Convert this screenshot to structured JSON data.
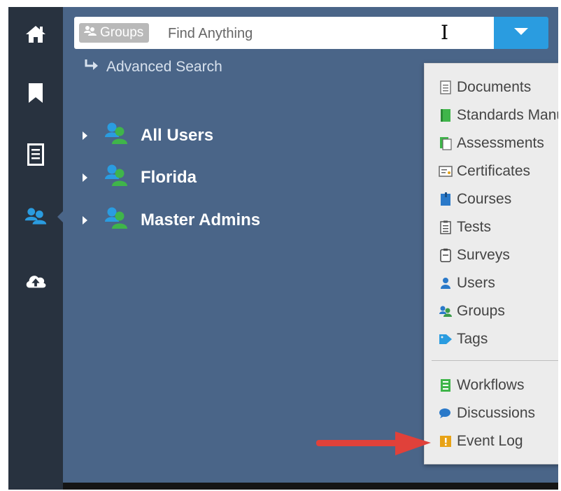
{
  "search": {
    "scope_label": "Groups",
    "placeholder": "Find Anything"
  },
  "advanced_search_label": "Advanced Search",
  "sidebar": {
    "items": [
      {
        "name": "home-icon"
      },
      {
        "name": "bookmark-icon"
      },
      {
        "name": "document-list-icon"
      },
      {
        "name": "users-icon"
      },
      {
        "name": "cloud-upload-icon"
      }
    ]
  },
  "groups_tree": [
    {
      "label": "All Users"
    },
    {
      "label": "Florida"
    },
    {
      "label": "Master Admins"
    }
  ],
  "menu": {
    "items": [
      {
        "label": "Documents",
        "icon": "document-icon"
      },
      {
        "label": "Standards Manuals",
        "icon": "manual-icon"
      },
      {
        "label": "Assessments",
        "icon": "assessment-icon"
      },
      {
        "label": "Certificates",
        "icon": "certificate-icon"
      },
      {
        "label": "Courses",
        "icon": "course-icon"
      },
      {
        "label": "Tests",
        "icon": "test-icon"
      },
      {
        "label": "Surveys",
        "icon": "survey-icon"
      },
      {
        "label": "Users",
        "icon": "user-icon"
      },
      {
        "label": "Groups",
        "icon": "groups-icon"
      },
      {
        "label": "Tags",
        "icon": "tag-icon"
      }
    ],
    "items_secondary": [
      {
        "label": "Workflows",
        "icon": "workflow-icon"
      },
      {
        "label": "Discussions",
        "icon": "discussion-icon"
      },
      {
        "label": "Event Log",
        "icon": "event-log-icon"
      }
    ]
  },
  "colors": {
    "sidebar": "#28323f",
    "main": "#4a6588",
    "accent": "#2a9ce0",
    "annotation_arrow": "#e0413a"
  }
}
